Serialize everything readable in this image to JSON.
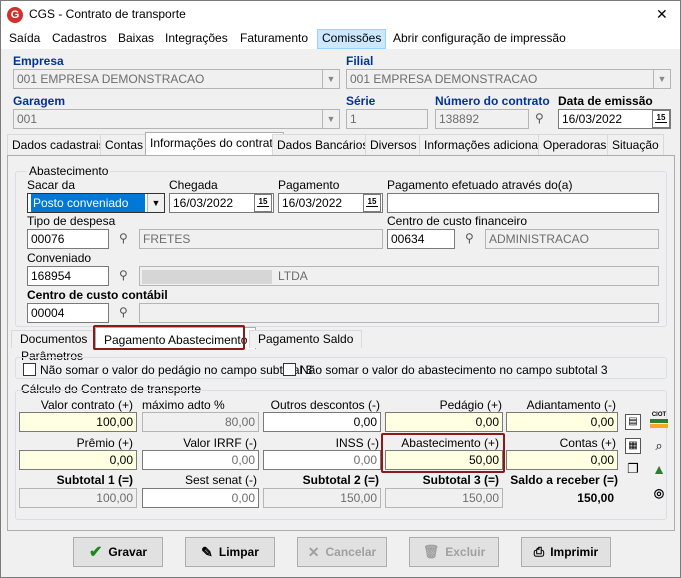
{
  "window": {
    "title": "CGS - Contrato de transporte",
    "close_glyph": "✕"
  },
  "menu": [
    "Saída",
    "Cadastros",
    "Baixas",
    "Integrações",
    "Faturamento",
    "Comissões",
    "Abrir configuração de impressão"
  ],
  "header": {
    "empresa_label": "Empresa",
    "empresa_value": "001 EMPRESA DEMONSTRACAO",
    "filial_label": "Filial",
    "filial_value": "001 EMPRESA DEMONSTRACAO",
    "garagem_label": "Garagem",
    "garagem_value": "001",
    "serie_label": "Série",
    "serie_value": "1",
    "numero_label": "Número do contrato",
    "numero_value": "138892",
    "data_label": "Data de emissão",
    "data_value": "16/03/2022"
  },
  "tabs": [
    "Dados cadastrais",
    "Contas",
    "Informações do contrato",
    "Dados Bancários",
    "Diversos",
    "Informações adicionais",
    "Operadoras",
    "Situação"
  ],
  "abastecimento": {
    "group_title": "Abastecimento",
    "sacar_label": "Sacar da",
    "sacar_value": "Posto conveniado",
    "chegada_label": "Chegada",
    "chegada_value": "16/03/2022",
    "pagamento_label": "Pagamento",
    "pagamento_value": "16/03/2022",
    "pag_efetuado_label": "Pagamento efetuado através do(a)",
    "pag_efetuado_value": "",
    "tipo_despesa_label": "Tipo de despesa",
    "tipo_despesa_code": "00076",
    "tipo_despesa_desc": "FRETES",
    "centro_fin_label": "Centro de custo financeiro",
    "centro_fin_code": "00634",
    "centro_fin_desc": "ADMINISTRACAO",
    "conveniado_label": "Conveniado",
    "conveniado_code": "168954",
    "conveniado_desc": "LTDA",
    "centro_cont_label": "Centro de custo contábil",
    "centro_cont_code": "00004",
    "centro_cont_desc": ""
  },
  "subtabs": [
    "Documentos",
    "Pagamento Abastecimento",
    "Pagamento Saldo"
  ],
  "parametros": {
    "title": "Parâmetros",
    "opt1": "Não somar o valor do pedágio no campo subtotal 3",
    "opt2": "Não somar o valor do abastecimento no campo subtotal 3"
  },
  "calculo": {
    "title": "Cálculo do Contrato de transporte",
    "row1_labels": [
      "Valor contrato (+)",
      "máximo adto %",
      "Outros descontos (-)",
      "Pedágio (+)",
      "Adiantamento (-)"
    ],
    "row1_values": [
      "100,00",
      "80,00",
      "0,00",
      "0,00",
      "0,00"
    ],
    "row2_labels": [
      "Prêmio (+)",
      "Valor IRRF (-)",
      "INSS (-)",
      "Abastecimento (+)",
      "Contas (+)"
    ],
    "row2_values": [
      "0,00",
      "0,00",
      "0,00",
      "50,00",
      "0,00"
    ],
    "row3_labels": [
      "Subtotal 1 (=)",
      "Sest senat (-)",
      "Subtotal 2 (=)",
      "Subtotal 3 (=)",
      "Saldo a receber (=)"
    ],
    "row3_values": [
      "100,00",
      "0,00",
      "150,00",
      "150,00",
      "150,00"
    ],
    "ciot_label": "CIOT"
  },
  "buttons": {
    "gravar": "Gravar",
    "limpar": "Limpar",
    "cancelar": "Cancelar",
    "excluir": "Excluir",
    "imprimir": "Imprimir"
  },
  "colors": {
    "accent_highlight": "#8b1a1a",
    "yellow_field": "#ffffe1",
    "label_blue": "#003399"
  }
}
